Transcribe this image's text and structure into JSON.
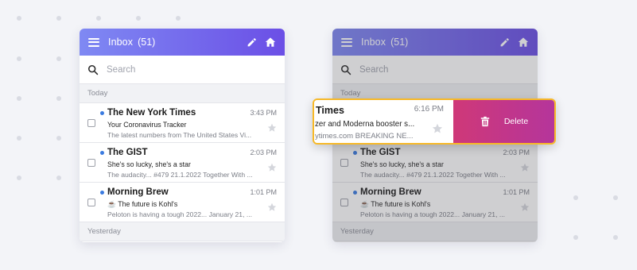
{
  "header": {
    "title": "Inbox",
    "count": "(51)",
    "menu_icon": "hamburger-menu-icon",
    "compose_icon": "pencil-icon",
    "home_icon": "home-icon"
  },
  "search": {
    "placeholder": "Search"
  },
  "sections": {
    "today": "Today",
    "yesterday": "Yesterday"
  },
  "emails": [
    {
      "sender": "The New York Times",
      "time": "3:43 PM",
      "subject": "Your Coronavirus Tracker",
      "preview": "The latest numbers from The United States Vi..."
    },
    {
      "sender": "The GIST",
      "time": "2:03 PM",
      "subject": "She's so lucky, she's a star",
      "preview": "The audacity... #479 21.1.2022 Together With ..."
    },
    {
      "sender": "Morning Brew",
      "time": "1:01 PM",
      "subject": "☕  The future is Kohl's",
      "preview": "Peloton is having a tough 2022... January 21, ..."
    }
  ],
  "swiped_email": {
    "sender": "Times",
    "time": "6:16 PM",
    "subject": "zer and Moderna booster s...",
    "preview": "ytimes.com BREAKING NE..."
  },
  "delete_action": {
    "label": "Delete",
    "icon": "trash-icon"
  },
  "colors": {
    "header_gradient_start": "#7f89f3",
    "header_gradient_end": "#6b4fe6",
    "unread_dot": "#3a7be0",
    "delete_gradient_start": "#cf3878",
    "delete_gradient_end": "#b5359b",
    "highlight_border": "#f7b928"
  }
}
